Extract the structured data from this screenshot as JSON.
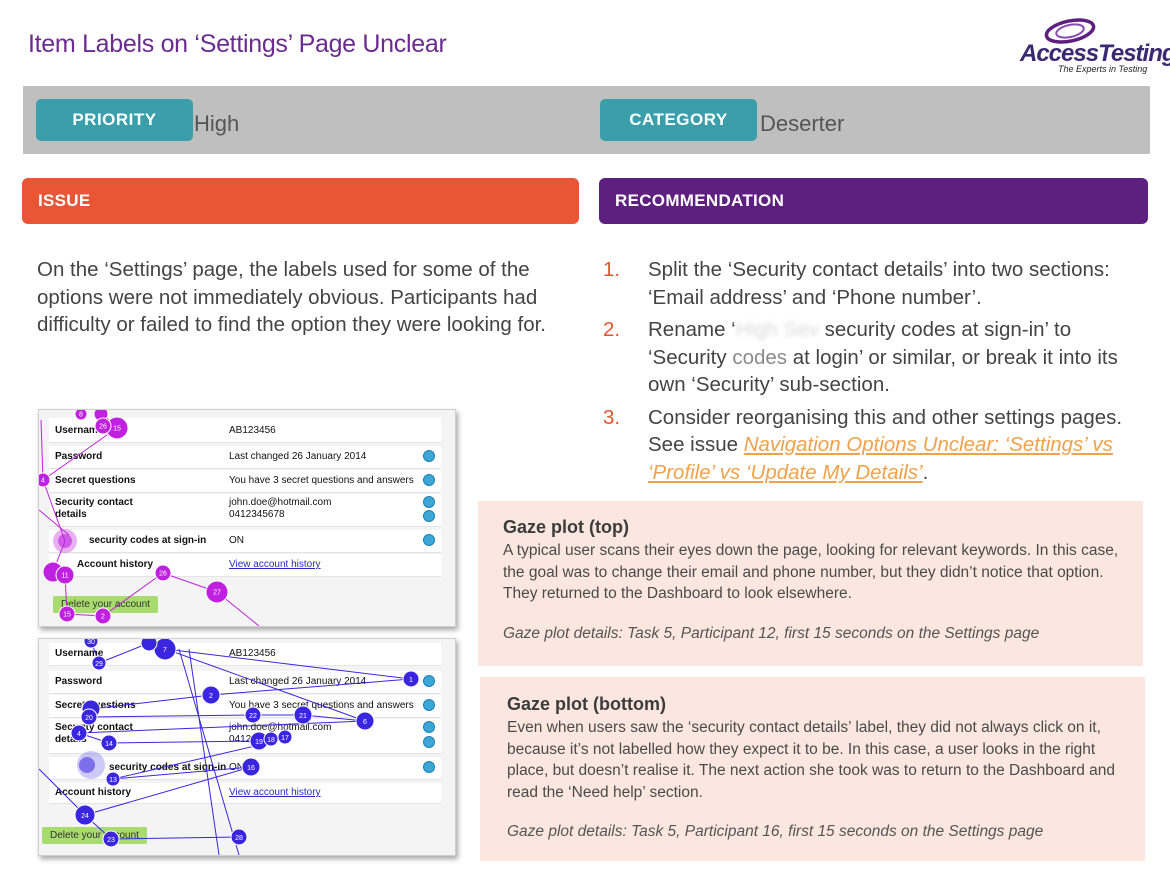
{
  "title": "Item Labels on ‘Settings’ Page Unclear",
  "logo": {
    "brand": "AccessTesting",
    "tagline": "The Experts in Testing"
  },
  "meta": {
    "priority_label": "PRIORITY",
    "priority_value": "High",
    "category_label": "CATEGORY",
    "category_value": "Deserter"
  },
  "issue": {
    "header": "ISSUE",
    "text": "On the ‘Settings’ page, the labels used for some of the options were not immediately obvious. Participants had difficulty or failed to find the option they were looking for."
  },
  "recommendation": {
    "header": "RECOMMENDATION",
    "items": [
      {
        "num": "1.",
        "text": "Split the ‘Security contact details’ into two sections: ‘Email address’ and ‘Phone number’."
      },
      {
        "num": "2.",
        "pre": "Rename ‘",
        "blurred": "High Sev",
        "mid": " security codes at sign-in’ to ‘Security ",
        "soft": "codes",
        "post": " at login’ or similar, or break it into its own ‘Security’ sub-section."
      },
      {
        "num": "3.",
        "pre": "Consider reorganising this and other settings pages. See issue ",
        "link": "Navigation Options Unclear: ‘Settings’ vs ‘Profile’ vs ‘Update My Details’",
        "post": "."
      }
    ]
  },
  "gaze_top": {
    "title": "Gaze plot (top)",
    "body": "A typical user scans their eyes down the page, looking for relevant keywords. In this case, the goal was to change their email and phone number, but they didn’t notice that option. They returned to the Dashboard to look elsewhere.",
    "details": "Gaze plot details: Task 5, Participant 12, first 15 seconds on the Settings page"
  },
  "gaze_bottom": {
    "title": "Gaze plot (bottom)",
    "body": "Even when users saw the ‘security contact details’ label, they did not always click on it, because it’s not labelled how they expect it to be. In this case, a user looks in the right place, but doesn’t realise it. The next action she took was to return to the Dashboard and read the ‘Need help’ section.",
    "details": "Gaze plot details: Task 5, Participant 16, first 15 seconds on the Settings page"
  },
  "screenshot_top": {
    "rows": [
      {
        "label": "Username",
        "value": "AB123456",
        "icon": false
      },
      {
        "label": "Password",
        "value": "Last changed 26 January 2014",
        "icon": true
      },
      {
        "label": "Secret questions",
        "value": "You have 3 secret questions and answers",
        "icon": true
      },
      {
        "label": "Security contact details",
        "value": "john.doe@hotmail.com 0412345678",
        "icon": true
      },
      {
        "label": "security codes at sign-in",
        "value": "ON",
        "icon": true
      },
      {
        "label": "Account history",
        "value": "View account history",
        "icon": false
      }
    ],
    "button": "Delete your account",
    "fixations": [
      "8",
      "26",
      "15",
      "4",
      "11",
      "15",
      "2",
      "26",
      "27"
    ]
  },
  "screenshot_bottom": {
    "rows": [
      {
        "label": "Username",
        "value": "AB123456",
        "icon": false
      },
      {
        "label": "Password",
        "value": "Last changed 26 January 2014",
        "icon": true
      },
      {
        "label": "Secret questions",
        "value": "You have 3 secret questions and answers",
        "icon": true
      },
      {
        "label": "Security contact details",
        "value": "john.doe@hotmail.com 0412345678",
        "icon": true
      },
      {
        "label": "security codes at sign-in",
        "value": "ON",
        "icon": true
      },
      {
        "label": "Account history",
        "value": "View account history",
        "icon": false
      }
    ],
    "button": "Delete your account",
    "fixations": [
      "30",
      "29",
      "7",
      "1",
      "2",
      "20",
      "22",
      "21",
      "6",
      "4",
      "14",
      "19",
      "18",
      "17",
      "13",
      "16",
      "24",
      "23",
      "28"
    ]
  },
  "colors": {
    "purple": "#6a2c8e",
    "teal": "#3a9faa",
    "issue_orange": "#e95535",
    "recommendation_purple": "#5e2080",
    "gaze_bg": "#fbe7df",
    "link_orange": "#f0a14a",
    "fixation_magenta": "#c020e0",
    "fixation_blue": "#3a26e0"
  }
}
